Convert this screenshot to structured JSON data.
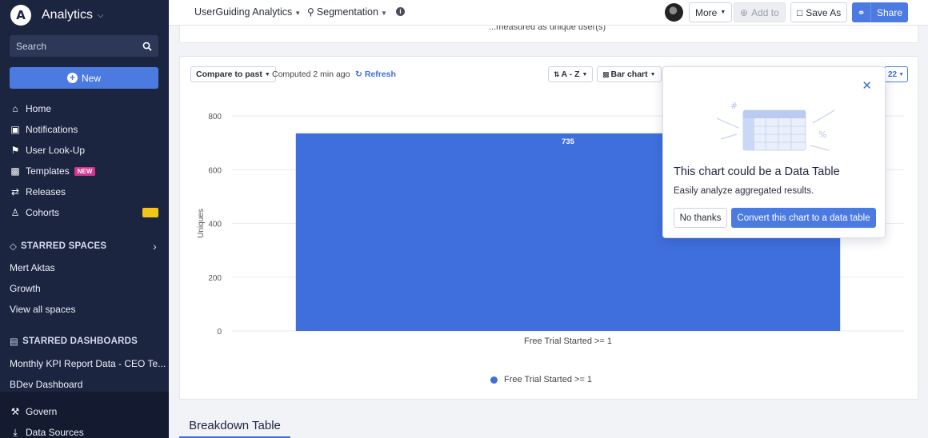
{
  "sidebar": {
    "app_name": "Analytics",
    "search_placeholder": "Search",
    "new_label": "New",
    "nav": [
      {
        "label": "Home",
        "icon": "home-icon"
      },
      {
        "label": "Notifications",
        "icon": "notifications-icon"
      },
      {
        "label": "User Look-Up",
        "icon": "user-lookup-icon"
      },
      {
        "label": "Templates",
        "icon": "templates-icon",
        "badge": "NEW"
      },
      {
        "label": "Releases",
        "icon": "releases-icon"
      },
      {
        "label": "Cohorts",
        "icon": "cohorts-icon"
      }
    ],
    "starred_spaces_label": "STARRED SPACES",
    "spaces": [
      "Mert Aktas",
      "Growth",
      "View all spaces"
    ],
    "starred_dashboards_label": "STARRED DASHBOARDS",
    "dashboards": [
      "Monthly KPI Report Data - CEO Te...",
      "BDev Dashboard"
    ],
    "bottom": [
      {
        "label": "Govern",
        "icon": "govern-icon"
      },
      {
        "label": "Data Sources",
        "icon": "data-sources-icon"
      }
    ]
  },
  "topbar": {
    "project": "UserGuiding Analytics",
    "chart_type": "Segmentation",
    "more": "More",
    "add_to": "Add to",
    "save_as": "Save As",
    "share": "Share"
  },
  "top_card": {
    "subtitle": "...measured as unique user(s)"
  },
  "controls": {
    "compare": "Compare to past",
    "computed": "Computed 2 min ago",
    "refresh": "Refresh",
    "sort": "A - Z",
    "chart_type": "Bar chart",
    "date_fragment": "22"
  },
  "chart_data": {
    "type": "bar",
    "categories": [
      "Free Trial Started >= 1"
    ],
    "series": [
      {
        "name": "Free Trial Started >= 1",
        "values": [
          735
        ]
      }
    ],
    "ylabel": "Uniques",
    "ylim": [
      0,
      800
    ],
    "yticks": [
      0,
      200,
      400,
      600,
      800
    ],
    "grid": true,
    "legend_position": "bottom",
    "bar_color": "#3f6fdd"
  },
  "popup": {
    "title": "This chart could be a Data Table",
    "description": "Easily analyze aggregated results.",
    "no_label": "No thanks",
    "yes_label": "Convert this chart to a data table"
  },
  "breakdown_tab": "Breakdown Table",
  "colors": {
    "accent": "#4b7ae0",
    "sidebar": "#1c2540",
    "badge": "#d6338f"
  }
}
